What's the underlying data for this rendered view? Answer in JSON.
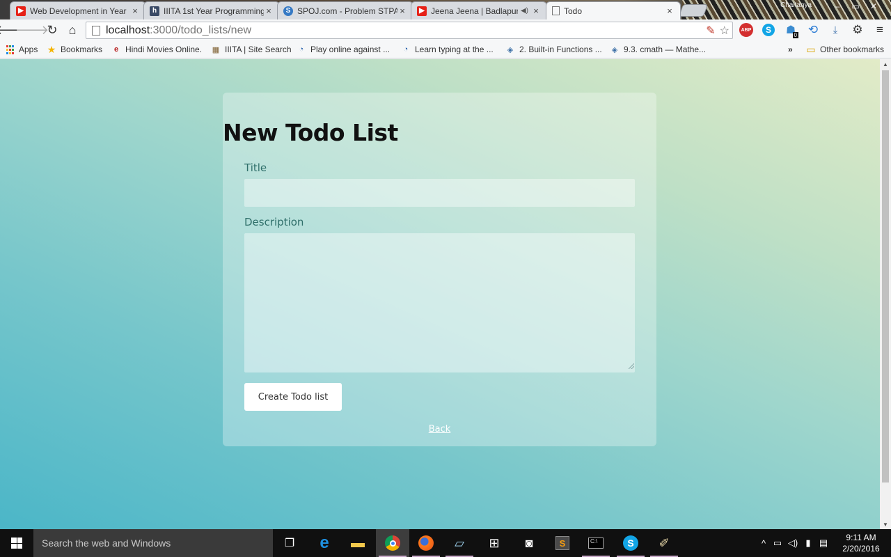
{
  "browser": {
    "user": "Chaitanya",
    "tabs": [
      {
        "title": "Web Development in Year",
        "icon": "youtube-icon"
      },
      {
        "title": "IIITA 1st Year Programming",
        "icon": "h-icon"
      },
      {
        "title": "SPOJ.com - Problem STPA",
        "icon": "spoj-icon"
      },
      {
        "title": "Jeena Jeena | Badlapur",
        "icon": "youtube-icon"
      },
      {
        "title": "Todo",
        "icon": "page-icon",
        "active": true
      }
    ],
    "url_host": "localhost",
    "url_path": ":3000/todo_lists/new",
    "bookmarks": [
      {
        "label": "Apps",
        "icon": "apps-icon"
      },
      {
        "label": "Bookmarks",
        "icon": "star-icon"
      },
      {
        "label": "Hindi Movies Online.",
        "icon": "film-icon"
      },
      {
        "label": "IIITA | Site Search",
        "icon": "site-icon"
      },
      {
        "label": "Play online against ...",
        "icon": "cursor-icon"
      },
      {
        "label": "Learn typing at the ...",
        "icon": "cursor-icon"
      },
      {
        "label": "2. Built-in Functions ...",
        "icon": "python-icon"
      },
      {
        "label": "9.3. cmath — Mathe...",
        "icon": "python-icon"
      }
    ],
    "more_bookmarks": "»",
    "other_bookmarks": "Other bookmarks",
    "extension_badge": "0"
  },
  "page": {
    "heading": "New Todo List",
    "title_label": "Title",
    "title_value": "",
    "description_label": "Description",
    "description_value": "",
    "submit_label": "Create Todo list",
    "back_label": "Back"
  },
  "taskbar": {
    "search_placeholder": "Search the web and Windows",
    "time": "9:11 AM",
    "date": "2/20/2016"
  }
}
